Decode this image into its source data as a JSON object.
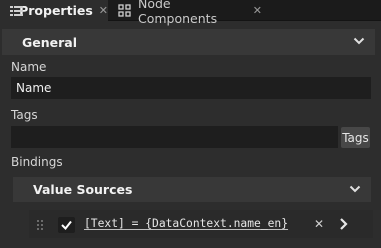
{
  "tabs": [
    {
      "label": "Properties",
      "icon": "list-icon",
      "active": true
    },
    {
      "label": "Node Components",
      "icon": "node-components-icon",
      "active": false
    }
  ],
  "general": {
    "title": "General",
    "name_label": "Name",
    "name_value": "Name",
    "tags_label": "Tags",
    "tags_value": "",
    "tags_button": "Tags",
    "bindings_label": "Bindings"
  },
  "value_sources": {
    "title": "Value Sources",
    "items": [
      {
        "enabled": true,
        "text": "[Text] = {DataContext.name_en}"
      }
    ]
  },
  "colors": {
    "background": "#2d2d2d",
    "tabbar": "#1b1b1b",
    "section_header": "#383838",
    "input": "#1e1e1e"
  }
}
